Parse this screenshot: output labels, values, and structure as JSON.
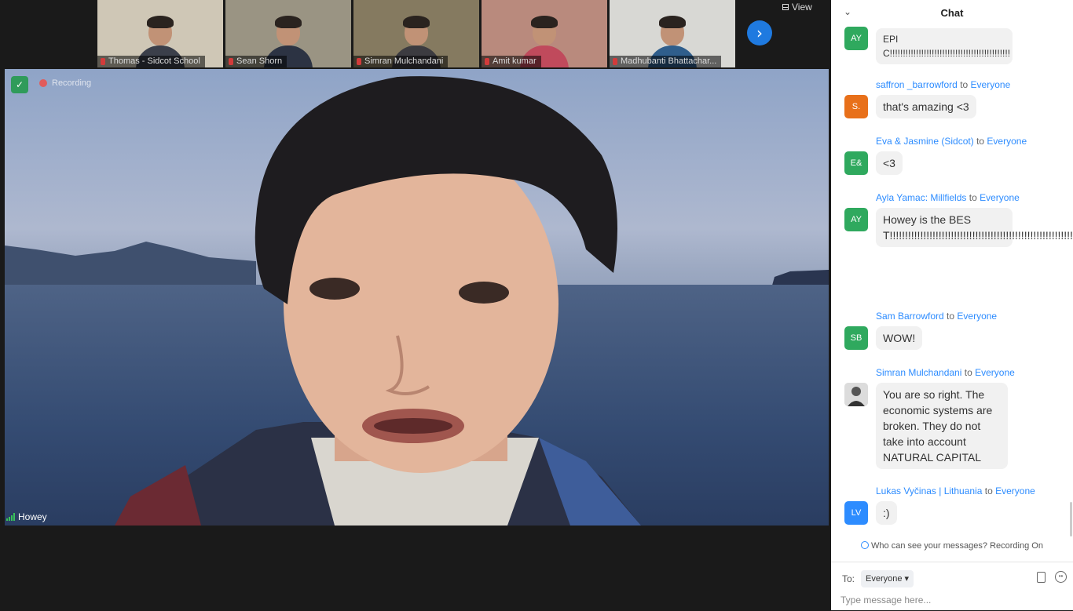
{
  "view_label": "View",
  "participants": [
    {
      "name": "Thomas - Sidcot School",
      "room": "#cfc7b6",
      "body": "#3b3f4a"
    },
    {
      "name": "Sean Shorn",
      "room": "#9a9483",
      "body": "#2c3343"
    },
    {
      "name": "Simran Mulchandani",
      "room": "#857a60",
      "body": "#3c3b40"
    },
    {
      "name": "Amit kumar",
      "room": "#b98a7d",
      "body": "#c04a5c"
    },
    {
      "name": "Madhubanti Bhattachar...",
      "room": "#d8d8d4",
      "body": "#2f5e8c"
    }
  ],
  "video": {
    "recording_label": "Recording",
    "speaker_name": "Howey"
  },
  "chat": {
    "title": "Chat",
    "messages": [
      {
        "sender": "",
        "to": "",
        "avatar": "AY",
        "avatar_color": "#2fa95e",
        "text": "EPIC!!!!!!!!!!!!!!!!!!!!!!!!!!!!!!!!!!!!!!!!!!!!!!"
      },
      {
        "sender": "saffron _barrowford",
        "to": "Everyone",
        "avatar": "S.",
        "avatar_color": "#e8701a",
        "text": "that's amazing <3"
      },
      {
        "sender": "Eva & Jasmine (Sidcot)",
        "to": "Everyone",
        "avatar": "E&",
        "avatar_color": "#2fa95e",
        "text": "<3"
      },
      {
        "sender": "Ayla Yamac: Millfields",
        "to": "Everyone",
        "avatar": "AY",
        "avatar_color": "#2fa95e",
        "text": "Howey is the BEST!!!!!!!!!!!!!!!!!!!!!!!!!!!!!!!!!!!!!!!!!!!!!!!!!!!!!!!!!!!!!!!!!!!!!!!!!!!!!!!!!!!!!!!!!!!!!!!!!!"
      },
      {
        "sender": "Sam Barrowford",
        "to": "Everyone",
        "avatar": "SB",
        "avatar_color": "#2fa95e",
        "text": "WOW!"
      },
      {
        "sender": "Simran Mulchandani",
        "to": "Everyone",
        "avatar": "",
        "avatar_color": "#555555",
        "text": "You are so right. The economic systems are broken. They do not take into account NATURAL CAPITAL"
      },
      {
        "sender": "Lukas Vyčinas | Lithuania",
        "to": "Everyone",
        "avatar": "LV",
        "avatar_color": "#2d8cff",
        "text": ":)"
      }
    ],
    "to_word": "to",
    "notice": "Who can see your messages? Recording On",
    "to_label": "To:",
    "to_value": "Everyone",
    "input_placeholder": "Type message here..."
  }
}
